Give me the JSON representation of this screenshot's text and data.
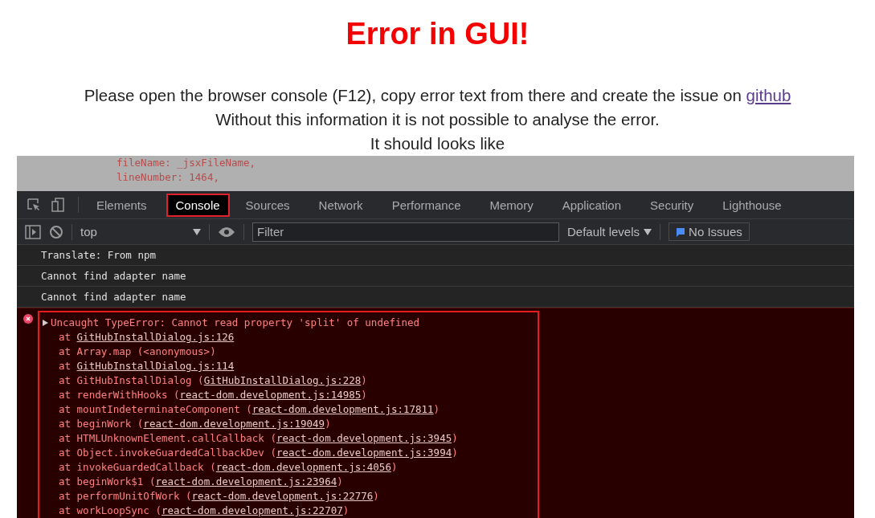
{
  "heading": "Error in GUI!",
  "message": {
    "text": "Please open the browser console (F12), copy error text from there and create the issue on ",
    "link": "github"
  },
  "lines": [
    "Without this information it is not possible to analyse the error.",
    "It should looks like"
  ],
  "screenshot": {
    "source_lines": [
      "fileName: _jsxFileName,",
      "lineNumber: 1464,"
    ],
    "tabs": [
      {
        "label": "Elements",
        "selected": false
      },
      {
        "label": "Console",
        "selected": true
      },
      {
        "label": "Sources",
        "selected": false
      },
      {
        "label": "Network",
        "selected": false
      },
      {
        "label": "Performance",
        "selected": false
      },
      {
        "label": "Memory",
        "selected": false
      },
      {
        "label": "Application",
        "selected": false
      },
      {
        "label": "Security",
        "selected": false
      },
      {
        "label": "Lighthouse",
        "selected": false
      }
    ],
    "context": "top",
    "filter": {
      "placeholder": "Filter"
    },
    "levels": "Default levels",
    "issues": "No Issues",
    "logs": [
      "Translate: From npm",
      "Cannot find adapter name",
      "Cannot find adapter name"
    ],
    "error": {
      "message": "Uncaught TypeError: Cannot read property 'split' of undefined",
      "frames": [
        {
          "text": "at ",
          "link": "GitHubInstallDialog.js:126"
        },
        {
          "text": "at Array.map (<anonymous>)"
        },
        {
          "text": "at ",
          "link": "GitHubInstallDialog.js:114"
        },
        {
          "text": "at GitHubInstallDialog (",
          "link": "GitHubInstallDialog.js:228",
          "suffix": ")"
        },
        {
          "text": "at renderWithHooks (",
          "link": "react-dom.development.js:14985",
          "suffix": ")"
        },
        {
          "text": "at mountIndeterminateComponent (",
          "link": "react-dom.development.js:17811",
          "suffix": ")"
        },
        {
          "text": "at beginWork (",
          "link": "react-dom.development.js:19049",
          "suffix": ")"
        },
        {
          "text": "at HTMLUnknownElement.callCallback (",
          "link": "react-dom.development.js:3945",
          "suffix": ")"
        },
        {
          "text": "at Object.invokeGuardedCallbackDev (",
          "link": "react-dom.development.js:3994",
          "suffix": ")"
        },
        {
          "text": "at invokeGuardedCallback (",
          "link": "react-dom.development.js:4056",
          "suffix": ")"
        },
        {
          "text": "at beginWork$1 (",
          "link": "react-dom.development.js:23964",
          "suffix": ")"
        },
        {
          "text": "at performUnitOfWork (",
          "link": "react-dom.development.js:22776",
          "suffix": ")"
        },
        {
          "text": "at workLoopSync (",
          "link": "react-dom.development.js:22707",
          "suffix": ")"
        }
      ]
    }
  }
}
